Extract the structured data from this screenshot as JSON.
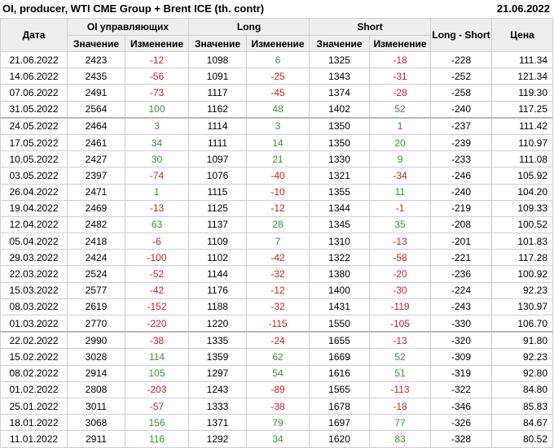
{
  "header": {
    "title": "OI, producer, WTI CME Group + Brent ICE (th. contr)",
    "date": "21.06.2022"
  },
  "columns": {
    "date": "Дата",
    "oi_group": "OI управляющих",
    "long_group": "Long",
    "short_group": "Short",
    "long_short": "Long - Short",
    "price": "Цена",
    "value": "Значение",
    "change": "Изменение"
  },
  "rows": [
    {
      "date": "21.06.2022",
      "oi": "2423",
      "oi_chg": "-12",
      "long": "1098",
      "long_chg": "6",
      "short": "1325",
      "short_chg": "-18",
      "ls": "-228",
      "price": "111.34"
    },
    {
      "date": "14.06.2022",
      "oi": "2435",
      "oi_chg": "-56",
      "long": "1091",
      "long_chg": "-25",
      "short": "1343",
      "short_chg": "-31",
      "ls": "-252",
      "price": "121.34"
    },
    {
      "date": "07.06.2022",
      "oi": "2491",
      "oi_chg": "-73",
      "long": "1117",
      "long_chg": "-45",
      "short": "1374",
      "short_chg": "-28",
      "ls": "-258",
      "price": "119.30"
    },
    {
      "date": "31.05.2022",
      "oi": "2564",
      "oi_chg": "100",
      "long": "1162",
      "long_chg": "48",
      "short": "1402",
      "short_chg": "52",
      "ls": "-240",
      "price": "117.25"
    },
    {
      "date": "24.05.2022",
      "oi": "2464",
      "oi_chg": "3",
      "long": "1114",
      "long_chg": "3",
      "short": "1350",
      "short_chg": "1",
      "ls": "-237",
      "price": "111.42"
    },
    {
      "date": "17.05.2022",
      "oi": "2461",
      "oi_chg": "34",
      "long": "1111",
      "long_chg": "14",
      "short": "1350",
      "short_chg": "20",
      "ls": "-239",
      "price": "110.97"
    },
    {
      "date": "10.05.2022",
      "oi": "2427",
      "oi_chg": "30",
      "long": "1097",
      "long_chg": "21",
      "short": "1330",
      "short_chg": "9",
      "ls": "-233",
      "price": "111.08"
    },
    {
      "date": "03.05.2022",
      "oi": "2397",
      "oi_chg": "-74",
      "long": "1076",
      "long_chg": "-40",
      "short": "1321",
      "short_chg": "-34",
      "ls": "-246",
      "price": "105.92"
    },
    {
      "date": "26.04.2022",
      "oi": "2471",
      "oi_chg": "1",
      "long": "1115",
      "long_chg": "-10",
      "short": "1355",
      "short_chg": "11",
      "ls": "-240",
      "price": "104.20"
    },
    {
      "date": "19.04.2022",
      "oi": "2469",
      "oi_chg": "-13",
      "long": "1125",
      "long_chg": "-12",
      "short": "1344",
      "short_chg": "-1",
      "ls": "-219",
      "price": "109.33"
    },
    {
      "date": "12.04.2022",
      "oi": "2482",
      "oi_chg": "63",
      "long": "1137",
      "long_chg": "28",
      "short": "1345",
      "short_chg": "35",
      "ls": "-208",
      "price": "100.52"
    },
    {
      "date": "05.04.2022",
      "oi": "2418",
      "oi_chg": "-6",
      "long": "1109",
      "long_chg": "7",
      "short": "1310",
      "short_chg": "-13",
      "ls": "-201",
      "price": "101.83"
    },
    {
      "date": "29.03.2022",
      "oi": "2424",
      "oi_chg": "-100",
      "long": "1102",
      "long_chg": "-42",
      "short": "1322",
      "short_chg": "-58",
      "ls": "-221",
      "price": "117.28"
    },
    {
      "date": "22.03.2022",
      "oi": "2524",
      "oi_chg": "-52",
      "long": "1144",
      "long_chg": "-32",
      "short": "1380",
      "short_chg": "-20",
      "ls": "-236",
      "price": "100.92"
    },
    {
      "date": "15.03.2022",
      "oi": "2577",
      "oi_chg": "-42",
      "long": "1176",
      "long_chg": "-12",
      "short": "1400",
      "short_chg": "-30",
      "ls": "-224",
      "price": "92.23"
    },
    {
      "date": "08.03.2022",
      "oi": "2619",
      "oi_chg": "-152",
      "long": "1188",
      "long_chg": "-32",
      "short": "1431",
      "short_chg": "-119",
      "ls": "-243",
      "price": "130.97"
    },
    {
      "date": "01.03.2022",
      "oi": "2770",
      "oi_chg": "-220",
      "long": "1220",
      "long_chg": "-115",
      "short": "1550",
      "short_chg": "-105",
      "ls": "-330",
      "price": "106.70"
    },
    {
      "date": "22.02.2022",
      "oi": "2990",
      "oi_chg": "-38",
      "long": "1335",
      "long_chg": "-24",
      "short": "1655",
      "short_chg": "-13",
      "ls": "-320",
      "price": "91.80"
    },
    {
      "date": "15.02.2022",
      "oi": "3028",
      "oi_chg": "114",
      "long": "1359",
      "long_chg": "62",
      "short": "1669",
      "short_chg": "52",
      "ls": "-309",
      "price": "92.23"
    },
    {
      "date": "08.02.2022",
      "oi": "2914",
      "oi_chg": "105",
      "long": "1297",
      "long_chg": "54",
      "short": "1616",
      "short_chg": "51",
      "ls": "-319",
      "price": "92.80"
    },
    {
      "date": "01.02.2022",
      "oi": "2808",
      "oi_chg": "-203",
      "long": "1243",
      "long_chg": "-89",
      "short": "1565",
      "short_chg": "-113",
      "ls": "-322",
      "price": "84.80"
    },
    {
      "date": "25.01.2022",
      "oi": "3011",
      "oi_chg": "-57",
      "long": "1333",
      "long_chg": "-38",
      "short": "1678",
      "short_chg": "-18",
      "ls": "-346",
      "price": "85.83"
    },
    {
      "date": "18.01.2022",
      "oi": "3068",
      "oi_chg": "156",
      "long": "1371",
      "long_chg": "79",
      "short": "1697",
      "short_chg": "77",
      "ls": "-326",
      "price": "84.67"
    },
    {
      "date": "11.01.2022",
      "oi": "2911",
      "oi_chg": "116",
      "long": "1292",
      "long_chg": "34",
      "short": "1620",
      "short_chg": "83",
      "ls": "-328",
      "price": "80.52"
    }
  ],
  "colors": {
    "positive": "#2a9d2a",
    "negative": "#d42020",
    "header_bg": "#eeeeee",
    "grid": "#cfcfcf"
  }
}
